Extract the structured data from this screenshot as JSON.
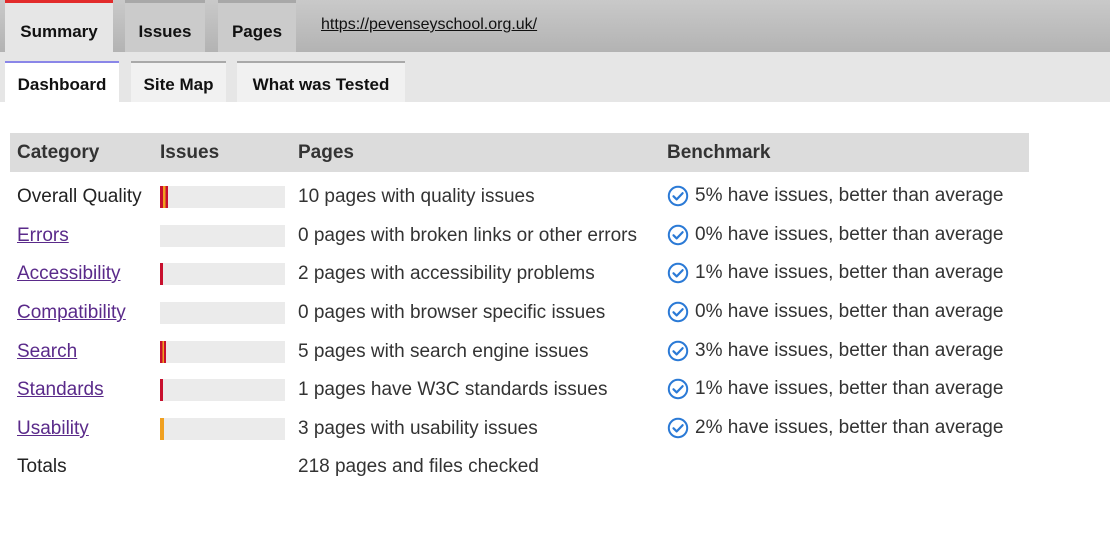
{
  "top_tabs": [
    {
      "label": "Summary",
      "active": true
    },
    {
      "label": "Issues",
      "active": false
    },
    {
      "label": "Pages",
      "active": false
    }
  ],
  "url": "https://pevenseyschool.org.uk/",
  "sub_tabs": [
    {
      "label": "Dashboard",
      "active": true
    },
    {
      "label": "Site Map",
      "active": false
    },
    {
      "label": "What was Tested",
      "active": false
    }
  ],
  "table": {
    "headers": [
      "Category",
      "Issues",
      "Pages",
      "Benchmark"
    ],
    "rows": [
      {
        "category": "Overall Quality",
        "link": false,
        "issue_fraction": 0.06,
        "bar_color": "#c8102e",
        "bar_stripe": "#f0a020",
        "pages": "10 pages with quality issues",
        "benchmark": "5% have issues, better than average"
      },
      {
        "category": "Errors",
        "link": true,
        "issue_fraction": 0,
        "bar_color": "#c8102e",
        "bar_stripe": "",
        "pages": "0 pages with broken links or other errors",
        "benchmark": "0% have issues, better than average"
      },
      {
        "category": "Accessibility",
        "link": true,
        "issue_fraction": 0.02,
        "bar_color": "#c8102e",
        "bar_stripe": "",
        "pages": "2 pages with accessibility problems",
        "benchmark": "1% have issues, better than average"
      },
      {
        "category": "Compatibility",
        "link": true,
        "issue_fraction": 0,
        "bar_color": "#c8102e",
        "bar_stripe": "",
        "pages": "0 pages with browser specific issues",
        "benchmark": "0% have issues, better than average"
      },
      {
        "category": "Search",
        "link": true,
        "issue_fraction": 0.05,
        "bar_color": "#c8102e",
        "bar_stripe": "#f0a020",
        "pages": "5 pages with search engine issues",
        "benchmark": "3% have issues, better than average"
      },
      {
        "category": "Standards",
        "link": true,
        "issue_fraction": 0.02,
        "bar_color": "#c8102e",
        "bar_stripe": "",
        "pages": "1 pages have W3C standards issues",
        "benchmark": "1% have issues, better than average"
      },
      {
        "category": "Usability",
        "link": true,
        "issue_fraction": 0.03,
        "bar_color": "#f0a020",
        "bar_stripe": "",
        "pages": "3 pages with usability issues",
        "benchmark": "2% have issues, better than average"
      }
    ],
    "totals": {
      "label": "Totals",
      "pages": "218 pages and files checked"
    }
  },
  "icons": {
    "benchmark": "check-circle-icon"
  },
  "colors": {
    "check": "#2b7ad6",
    "tab_active_border": "#e22b2b",
    "subtab_active_border": "#8a86e8"
  }
}
